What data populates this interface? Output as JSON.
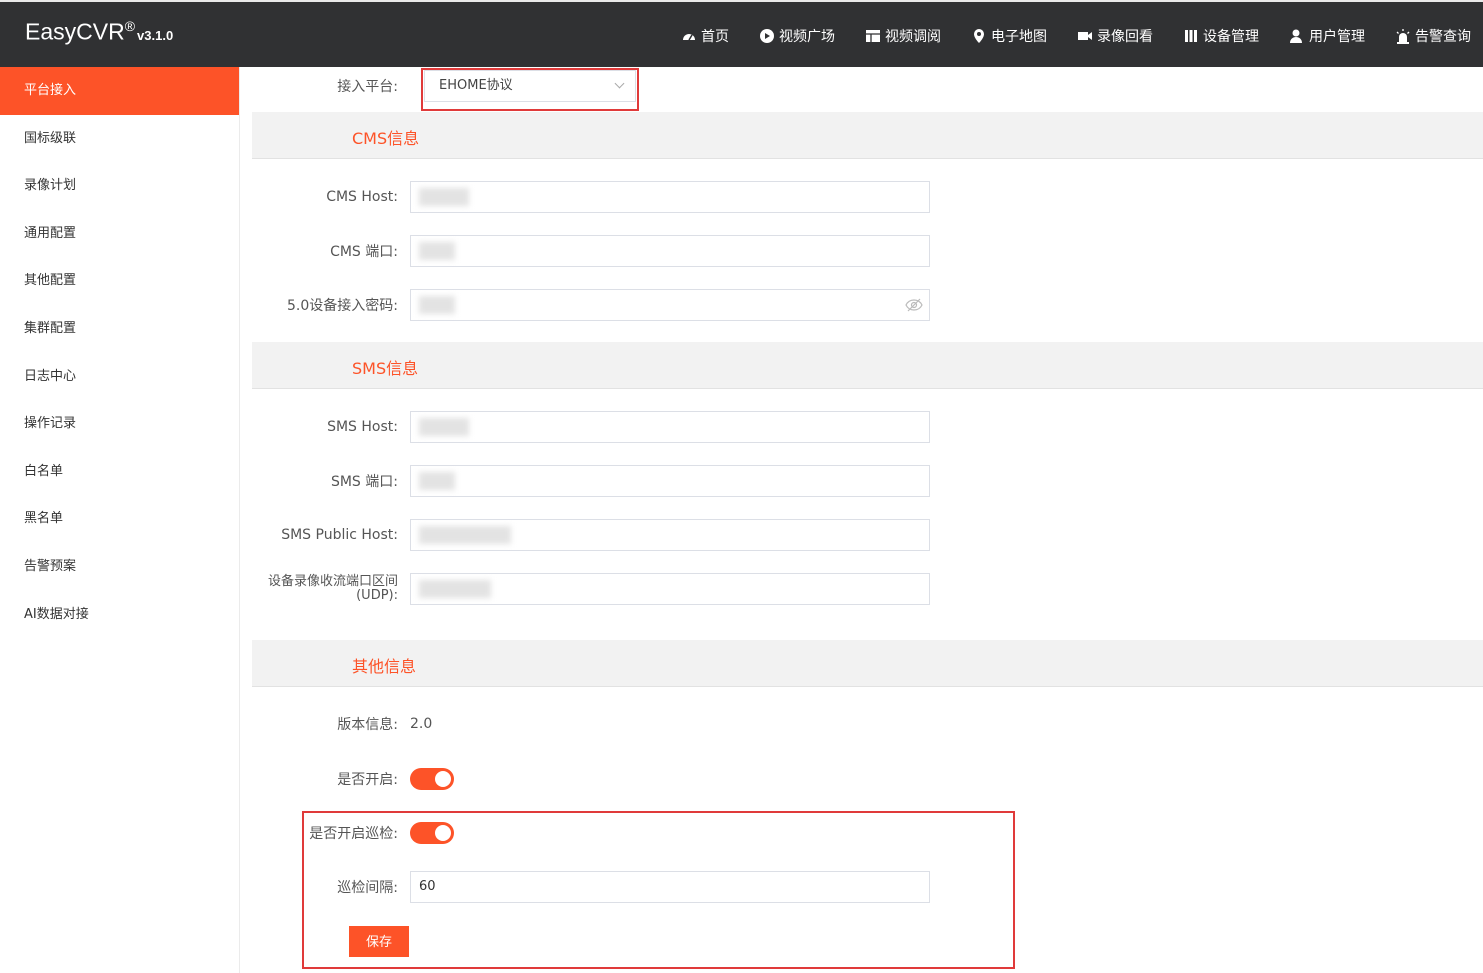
{
  "app": {
    "name": "EasyCVR",
    "reg": "®",
    "version": "v3.1.0"
  },
  "nav": [
    {
      "label": "首页",
      "icon": "dashboard-icon"
    },
    {
      "label": "视频广场",
      "icon": "play-icon"
    },
    {
      "label": "视频调阅",
      "icon": "grid-icon"
    },
    {
      "label": "电子地图",
      "icon": "map-pin-icon"
    },
    {
      "label": "录像回看",
      "icon": "video-camera-icon"
    },
    {
      "label": "设备管理",
      "icon": "device-icon"
    },
    {
      "label": "用户管理",
      "icon": "user-icon"
    },
    {
      "label": "告警查询",
      "icon": "alarm-icon"
    }
  ],
  "sidebar": {
    "items": [
      {
        "label": "平台接入"
      },
      {
        "label": "国标级联"
      },
      {
        "label": "录像计划"
      },
      {
        "label": "通用配置"
      },
      {
        "label": "其他配置"
      },
      {
        "label": "集群配置"
      },
      {
        "label": "日志中心"
      },
      {
        "label": "操作记录"
      },
      {
        "label": "白名单"
      },
      {
        "label": "黑名单"
      },
      {
        "label": "告警预案"
      },
      {
        "label": "AI数据对接"
      }
    ]
  },
  "form": {
    "platform_label": "接入平台:",
    "platform_value": "EHOME协议",
    "cms_section": "CMS信息",
    "cms_host_label": "CMS Host:",
    "cms_port_label": "CMS 端口:",
    "cms_password_label": "5.0设备接入密码:",
    "sms_section": "SMS信息",
    "sms_host_label": "SMS Host:",
    "sms_port_label": "SMS 端口:",
    "sms_public_host_label": "SMS Public Host:",
    "sms_udp_label_1": "设备录像收流端口区间",
    "sms_udp_label_2": "(UDP):",
    "other_section": "其他信息",
    "version_label": "版本信息:",
    "version_value": "2.0",
    "enable_label": "是否开启:",
    "enable_value": true,
    "patrol_label": "是否开启巡检:",
    "patrol_value": true,
    "interval_label": "巡检间隔:",
    "interval_value": "60",
    "save_label": "保存"
  },
  "colors": {
    "accent": "#fd5328",
    "topbar": "#303133",
    "highlight": "#e03a3a"
  }
}
